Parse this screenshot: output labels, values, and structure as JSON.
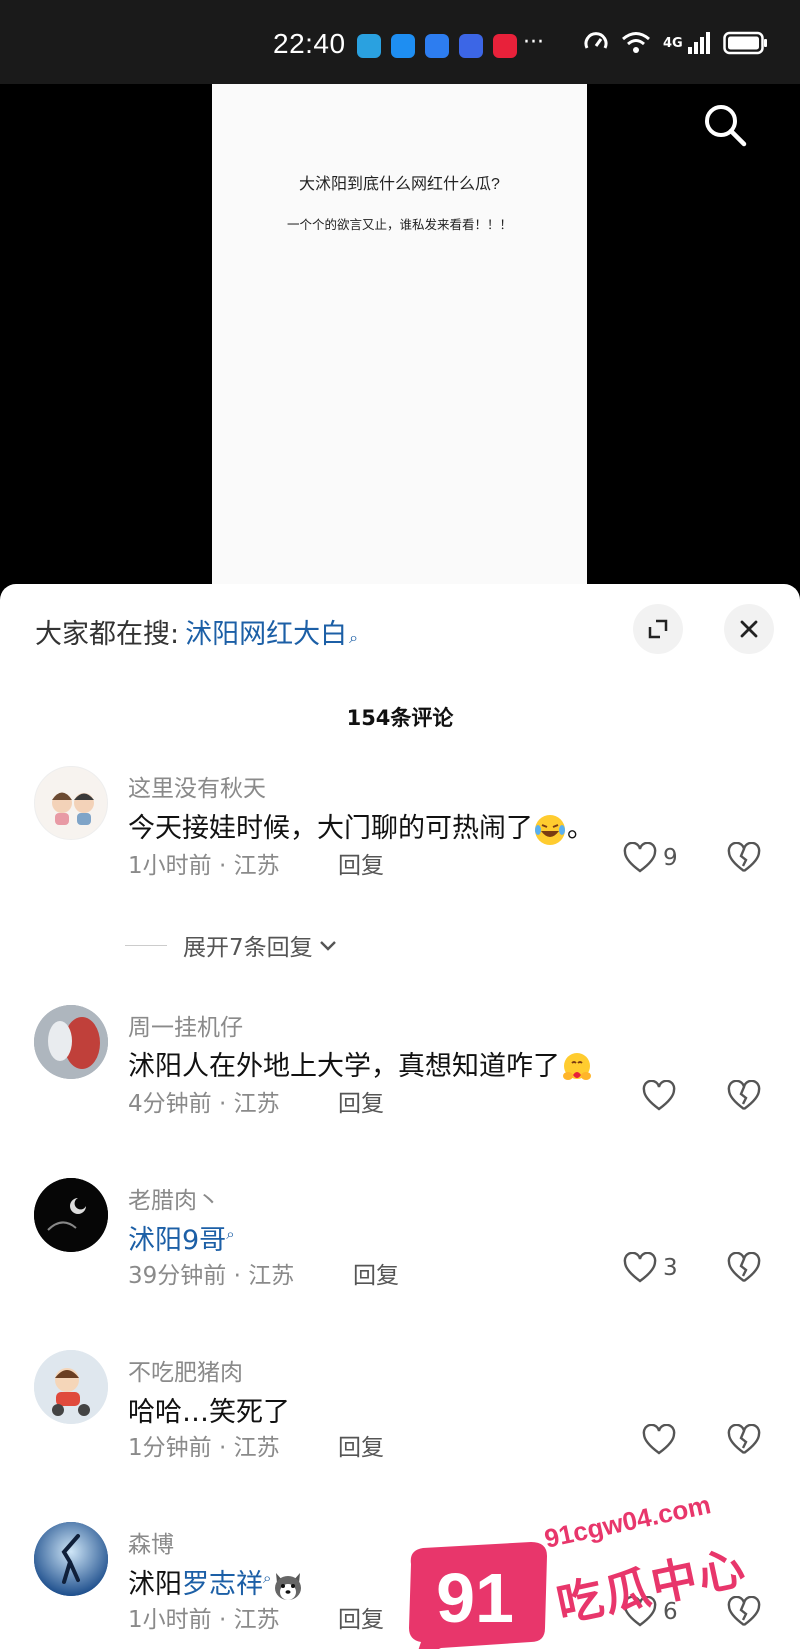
{
  "status_bar": {
    "time": "22:40",
    "dots": "···",
    "network": "4G"
  },
  "video": {
    "headline": "大沭阳到底什么网红什么瓜?",
    "subline": "一个个的欲言又止，谁私发来看看！！！"
  },
  "sheet": {
    "search_prefix": "大家都在搜:",
    "search_term": "沭阳网红大白",
    "comment_count": "154条评论",
    "reply_label": "回复"
  },
  "comments": [
    {
      "username": "这里没有秋天",
      "text": "今天接娃时候，大门聊的可热闹了",
      "text_suffix": "。",
      "time": "1小时前",
      "location": "江苏",
      "likes": "9",
      "expand_label": "展开7条回复"
    },
    {
      "username": "周一挂机仔",
      "text": "沭阳人在外地上大学，真想知道咋了",
      "time": "4分钟前",
      "location": "江苏",
      "likes": ""
    },
    {
      "username": "老腊肉丶",
      "text": "沭阳9哥",
      "time": "39分钟前",
      "location": "江苏",
      "likes": "3"
    },
    {
      "username": "不吃肥猪肉",
      "text": "哈哈…笑死了",
      "time": "1分钟前",
      "location": "江苏",
      "likes": ""
    },
    {
      "username": "森博",
      "text_prefix": "沭阳",
      "text_link": "罗志祥",
      "time": "1小时前",
      "location": "江苏",
      "likes": "6"
    }
  ],
  "watermark": {
    "url": "91cgw04.com",
    "badge": "91",
    "name": "吃瓜中心"
  },
  "colors": {
    "link": "#1c5fa6",
    "watermark": "#e8366b"
  }
}
